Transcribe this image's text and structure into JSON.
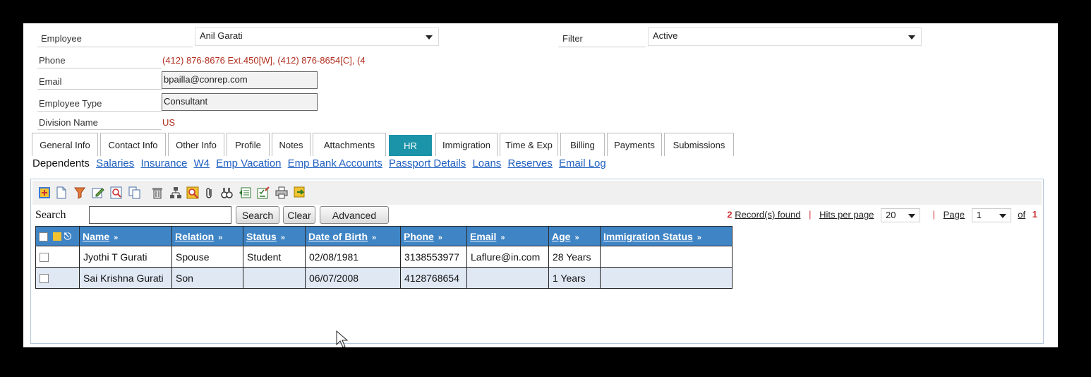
{
  "employee": {
    "label": "Employee",
    "value": "Anil  Garati"
  },
  "filter": {
    "label": "Filter",
    "value": "Active"
  },
  "phone": {
    "label": "Phone",
    "value": "(412) 876-8676 Ext.450[W], (412) 876-8654[C], (4"
  },
  "email": {
    "label": "Email",
    "value": "bpailla@conrep.com"
  },
  "employee_type": {
    "label": "Employee Type",
    "value": "Consultant"
  },
  "division": {
    "label": "Division Name",
    "value": "US"
  },
  "tabs": [
    "General Info",
    "Contact Info",
    "Other Info",
    "Profile",
    "Notes",
    "Attachments",
    "HR",
    "Immigration",
    "Time & Exp",
    "Billing",
    "Payments",
    "Submissions"
  ],
  "active_tab": "HR",
  "sublinks": {
    "current": "Dependents",
    "links": [
      "Salaries",
      "Insurance",
      "W4",
      "Emp Vacation",
      "Emp Bank Accounts",
      "Passport Details",
      "Loans",
      "Reserves",
      "Email Log"
    ]
  },
  "toolbar_icons": [
    "new-record-icon",
    "new-page-icon",
    "filter-icon",
    "edit-icon",
    "search-doc-icon",
    "copy-icon",
    "delete-icon",
    "hierarchy-icon",
    "find-icon",
    "attach-icon",
    "binocular-icon",
    "export-icon",
    "checklist-icon",
    "print-icon",
    "forward-icon"
  ],
  "search": {
    "label": "Search",
    "value": "",
    "search_button": "Search",
    "clear_button": "Clear",
    "advanced_button": "Advanced"
  },
  "pager": {
    "count": "2",
    "found_label": "Record(s) found",
    "hits_label": "Hits per page",
    "hits_value": "20",
    "page_label": "Page",
    "page_value": "1",
    "of_label": "of",
    "total_pages": "1"
  },
  "columns": [
    "Name",
    "Relation",
    "Status",
    "Date of Birth",
    "Phone",
    "Email",
    "Age",
    "Immigration Status"
  ],
  "rows": [
    {
      "name": "Jyothi T Gurati",
      "relation": "Spouse",
      "status": "Student",
      "dob": "02/08/1981",
      "phone": "3138553977",
      "email": "Laflure@in.com",
      "age": "28 Years",
      "immigration": ""
    },
    {
      "name": "Sai Krishna Gurati",
      "relation": "Son",
      "status": "",
      "dob": "06/07/2008",
      "phone": "4128768654",
      "email": "",
      "age": "1 Years",
      "immigration": ""
    }
  ],
  "colors": {
    "header_blue": "#3f84c5",
    "active_tab": "#1b93a8",
    "link_blue": "#1e5fbf",
    "accent_red": "#b03020",
    "row_alt": "#dfe8f3"
  }
}
